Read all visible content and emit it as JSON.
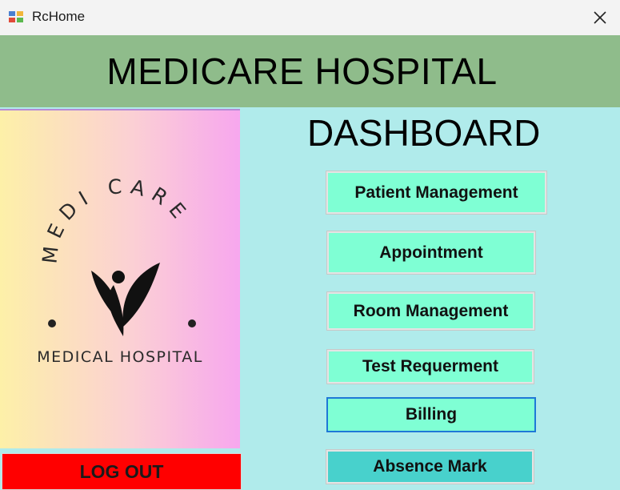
{
  "window": {
    "title": "RcHome",
    "icon": "app-window-icon",
    "close_icon": "close-icon"
  },
  "header": {
    "title": "MEDICARE HOSPITAL",
    "background": "#8fbc8b"
  },
  "logo": {
    "arc_text": "MEDI CARE",
    "subtitle": "MEDICAL HOSPITAL",
    "icon": "leaf-person-icon"
  },
  "dashboard": {
    "title": "DASHBOARD",
    "buttons": [
      {
        "label": "Patient Management"
      },
      {
        "label": "Appointment"
      },
      {
        "label": "Room Management"
      },
      {
        "label": "Test Requerment"
      },
      {
        "label": "Billing"
      },
      {
        "label": "Absence Mark"
      }
    ],
    "button_color": "#7fffd4",
    "alt_button_color": "#48d1cc",
    "background": "#b0ebeb"
  },
  "logout": {
    "label": "LOG OUT",
    "color": "#ff0000"
  }
}
